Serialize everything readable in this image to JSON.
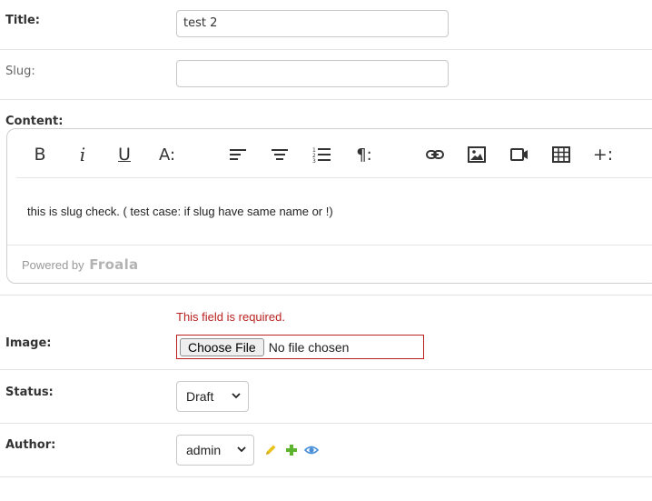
{
  "fields": {
    "title": {
      "label": "Title:",
      "value": "test 2"
    },
    "slug": {
      "label": "Slug:",
      "value": ""
    },
    "content": {
      "label": "Content:",
      "toolbar": [
        {
          "name": "bold-icon",
          "text": "B"
        },
        {
          "name": "italic-icon",
          "text": "i"
        },
        {
          "name": "underline-icon",
          "text": "U"
        },
        {
          "name": "text-more-icon",
          "text": "A:"
        },
        {
          "name": "align-left-icon"
        },
        {
          "name": "align-center-icon"
        },
        {
          "name": "ordered-list-icon"
        },
        {
          "name": "paragraph-more-icon",
          "text": "¶:"
        },
        {
          "name": "insert-link-icon"
        },
        {
          "name": "insert-image-icon"
        },
        {
          "name": "insert-video-icon"
        },
        {
          "name": "insert-table-icon"
        },
        {
          "name": "insert-more-icon",
          "text": "+:"
        }
      ],
      "body": "this is slug check. ( test case: if slug have same name or !)",
      "powered_by": "Powered by",
      "brand": "Froala"
    },
    "image": {
      "label": "Image:",
      "error": "This field is required.",
      "button": "Choose File",
      "status": "No file chosen"
    },
    "status": {
      "label": "Status:",
      "selected": "Draft"
    },
    "author": {
      "label": "Author:",
      "selected": "admin",
      "actions": [
        "edit-pencil-icon",
        "add-plus-icon",
        "view-eye-icon"
      ]
    }
  },
  "colors": {
    "error": "#ba2121",
    "pencil": "#e8c21a",
    "plus": "#5bb32e",
    "eye": "#4a90d9"
  }
}
